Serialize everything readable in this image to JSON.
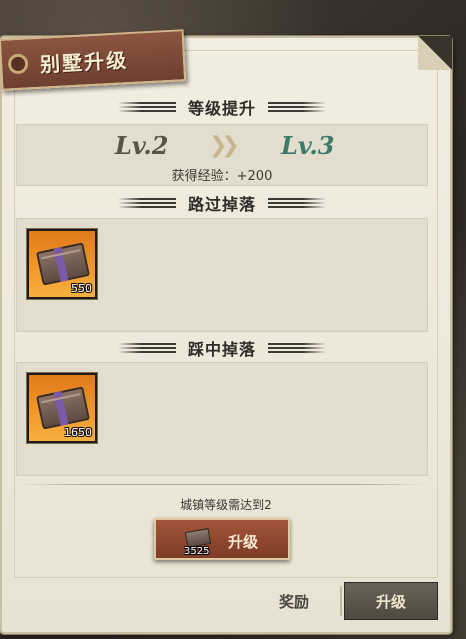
{
  "window": {
    "title": "别墅升级"
  },
  "level_section": {
    "header": "等级提升",
    "from": "Lv.2",
    "to": "Lv.3",
    "arrow_icon": "double-chevron-right",
    "exp_text": "获得经验：+200"
  },
  "pass_drop": {
    "header": "路过掉落",
    "items": [
      {
        "icon": "crate-icon",
        "count": "550"
      }
    ]
  },
  "step_drop": {
    "header": "踩中掉落",
    "items": [
      {
        "icon": "crate-icon",
        "count": "1650"
      }
    ]
  },
  "requirement": "城镇等级需达到2",
  "upgrade_button": {
    "cost": "3525",
    "label": "升级"
  },
  "tabs": [
    {
      "label": "奖励",
      "selected": false
    },
    {
      "label": "升级",
      "selected": true
    }
  ],
  "colors": {
    "panel": "#ede8da",
    "banner": "#7e4634",
    "level_next": "#3d7c69",
    "item_bg": "#f39a2c",
    "button": "#8f4630"
  }
}
